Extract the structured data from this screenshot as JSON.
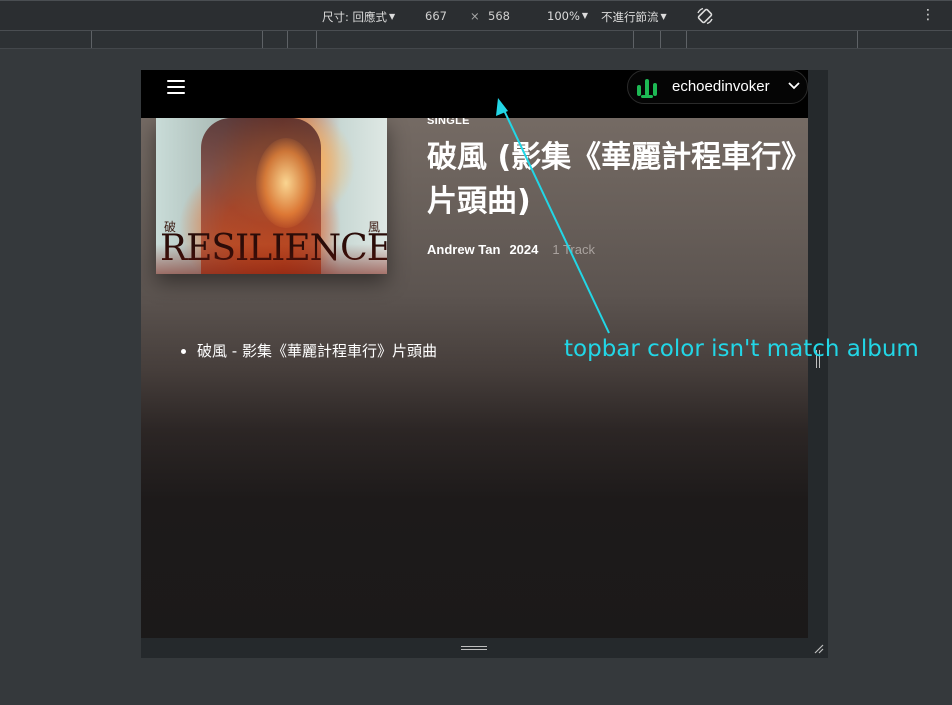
{
  "devtools": {
    "dimensions_label": "尺寸: 回應式",
    "width": "667",
    "times": "×",
    "height": "568",
    "zoom": "100%",
    "throttle": "不進行節流",
    "more": "⋮"
  },
  "page": {
    "user_name": "echoedinvoker",
    "album_kind": "SINGLE",
    "album_title": "破風 (影集《華麗計程車行》片頭曲)",
    "artist": "Andrew Tan",
    "year": "2024",
    "track_count": "1 Track",
    "cover_glyph_left": "破",
    "cover_glyph_right": "風",
    "cover_wordmark": "RESILIENCE",
    "tracks": [
      "破風 - 影集《華麗計程車行》片頭曲"
    ]
  },
  "annotation": {
    "text": "topbar color isn't match album",
    "color": "#22d6e6"
  },
  "colors": {
    "topbar": "#000000",
    "album_gradient_top": "#7b7069",
    "page_bottom": "#1b1919",
    "brand_green": "#1db954"
  }
}
